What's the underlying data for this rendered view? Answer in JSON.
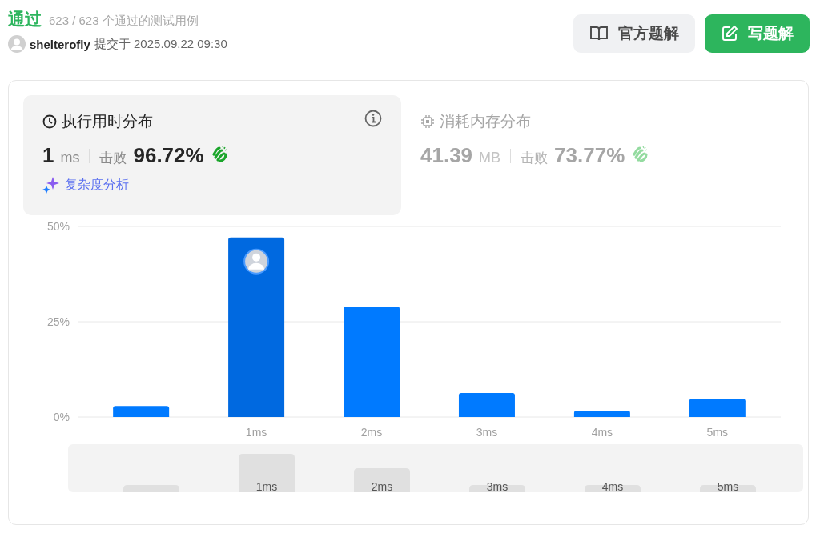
{
  "header": {
    "status": "通过",
    "tests": "623 / 623 个通过的测试用例",
    "user": "shelterofly",
    "submitted": "提交于 2025.09.22 09:30"
  },
  "buttons": [
    {
      "kind": "secondary",
      "label": "官方题解"
    },
    {
      "kind": "primary",
      "label": "写题解"
    }
  ],
  "cards": [
    {
      "kind": "time",
      "selected": true,
      "title": "执行用时分布",
      "value": "1",
      "unit": "ms",
      "beats_label": "击败",
      "beats": "96.72%",
      "link": "复杂度分析"
    },
    {
      "kind": "memory",
      "selected": false,
      "title": "消耗内存分布",
      "value": "41.39",
      "unit": "MB",
      "beats_label": "击败",
      "beats": "73.77%"
    }
  ],
  "chart_data": {
    "type": "bar",
    "x": [
      0,
      1,
      2,
      3,
      4,
      5
    ],
    "values": [
      2.9,
      47.1,
      29.0,
      6.3,
      1.7,
      4.8
    ],
    "xlim": [
      -0.55,
      5.55
    ],
    "ylim": [
      0,
      50
    ],
    "yticks": [
      {
        "value": 0,
        "label": "0%"
      },
      {
        "value": 25,
        "label": "25%"
      },
      {
        "value": 50,
        "label": "50%"
      }
    ],
    "xticks": [
      {
        "value": 1,
        "label": "1ms"
      },
      {
        "value": 2,
        "label": "2ms"
      },
      {
        "value": 3,
        "label": "3ms"
      },
      {
        "value": 4,
        "label": "4ms"
      },
      {
        "value": 5,
        "label": "5ms"
      }
    ]
  },
  "bars": [
    {
      "selected": false
    },
    {
      "selected": true
    },
    {
      "selected": false
    },
    {
      "selected": false
    },
    {
      "selected": false
    },
    {
      "selected": false
    }
  ],
  "overview": {
    "labels": [
      "1ms",
      "2ms",
      "3ms",
      "4ms",
      "5ms"
    ]
  }
}
